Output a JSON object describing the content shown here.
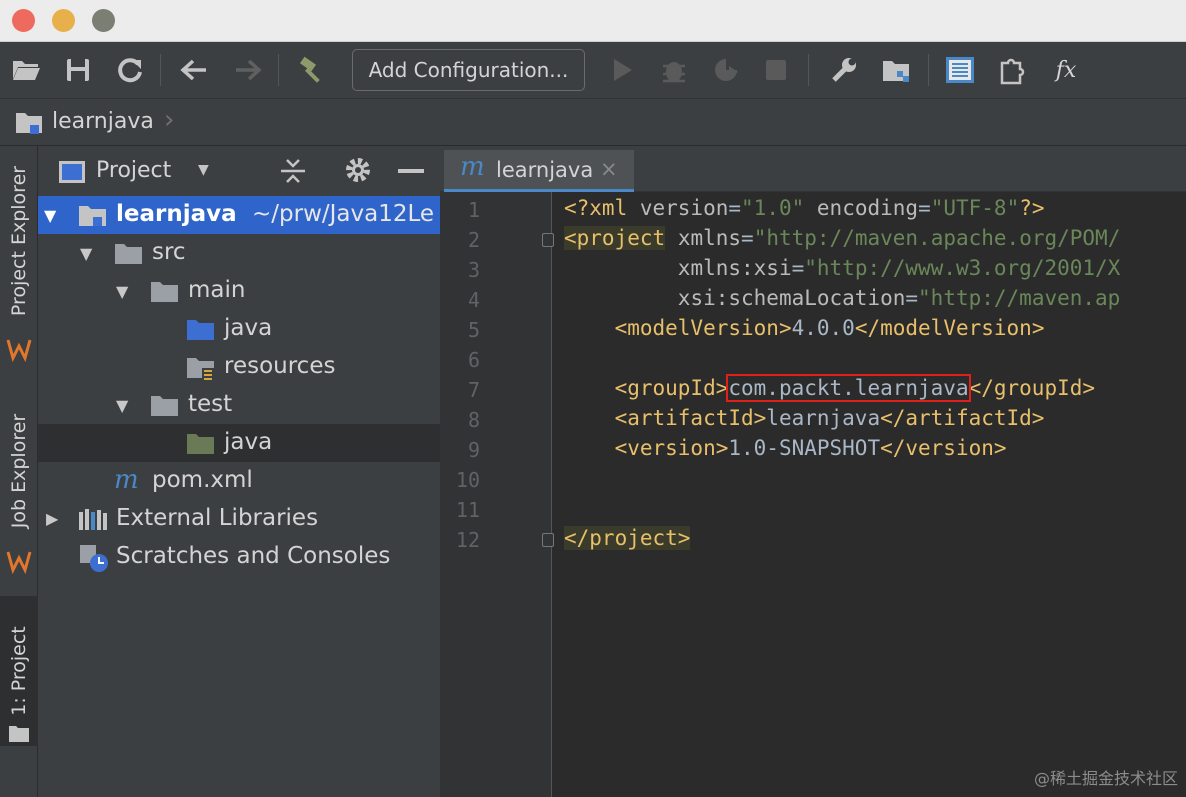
{
  "toolbar": {
    "add_configuration_label": "Add Configuration...",
    "icons": [
      "open-folder-icon",
      "save-icon",
      "sync-icon",
      "back-arrow-icon",
      "forward-arrow-icon",
      "build-hammer-icon",
      "run-icon",
      "debug-icon",
      "coverage-icon",
      "stop-icon",
      "settings-wrench-icon",
      "project-structure-icon",
      "list-view-icon",
      "plugin-icon",
      "fx-icon"
    ],
    "fx_label": "fx"
  },
  "navbar": {
    "project_label": "learnjava"
  },
  "stripe": {
    "tabs": [
      {
        "label": "Project Explorer"
      },
      {
        "label": "Job Explorer"
      },
      {
        "label": "1: Project"
      }
    ]
  },
  "panel": {
    "title": "Project",
    "tree": [
      {
        "label": "learnjava",
        "path": "~/prw/Java12Le",
        "level": 0,
        "arrow": "▼"
      },
      {
        "label": "src",
        "level": 1,
        "arrow": "▼"
      },
      {
        "label": "main",
        "level": 2,
        "arrow": "▼"
      },
      {
        "label": "java",
        "level": 3,
        "arrow": ""
      },
      {
        "label": "resources",
        "level": 3,
        "arrow": ""
      },
      {
        "label": "test",
        "level": 2,
        "arrow": "▼"
      },
      {
        "label": "java",
        "level": 3,
        "arrow": ""
      },
      {
        "label": "pom.xml",
        "level": 1,
        "arrow": ""
      },
      {
        "label": "External Libraries",
        "level": 0,
        "arrow": "▶"
      },
      {
        "label": "Scratches and Consoles",
        "level": 0,
        "arrow": ""
      }
    ]
  },
  "editor": {
    "tab_label": "learnjava",
    "tab_close": "×",
    "line_numbers": [
      "1",
      "2",
      "3",
      "4",
      "5",
      "6",
      "7",
      "8",
      "9",
      "10",
      "11",
      "12"
    ],
    "code": {
      "l1_open": "<?xml ",
      "l1_attr1": "version",
      "l1_val1": "\"1.0\"",
      "l1_attr2": "encoding",
      "l1_val2": "\"UTF-8\"",
      "l1_close": "?>",
      "l2_tag": "<project",
      "l2_attr": "xmlns",
      "l2_val": "\"http://maven.apache.org/POM/",
      "l3_attr": "xmlns:xsi",
      "l3_val": "\"http://www.w3.org/2001/X",
      "l4_attr": "xsi:schemaLocation",
      "l4_val": "\"http://maven.ap",
      "l5_open": "<modelVersion>",
      "l5_text": "4.0.0",
      "l5_close": "</modelVersion>",
      "l7_open": "<groupId>",
      "l7_text": "com.packt.learnjava",
      "l7_close": "</groupId>",
      "l8_open": "<artifactId>",
      "l8_text": "learnjava",
      "l8_close": "</artifactId>",
      "l9_open": "<version>",
      "l9_text": "1.0-SNAPSHOT",
      "l9_close": "</version>",
      "l12_close": "</project>"
    }
  },
  "watermark": "@稀土掘金技术社区",
  "colors": {
    "accent": "#2f65ca",
    "tag": "#e8bf6a",
    "value": "#6a8759",
    "highlight_box": "#e0201b"
  }
}
